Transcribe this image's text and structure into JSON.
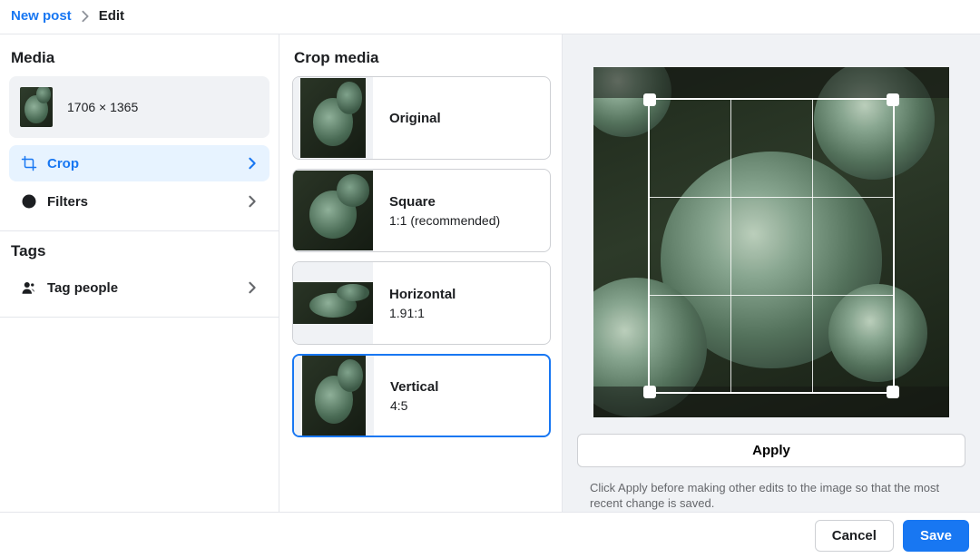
{
  "breadcrumb": {
    "back_label": "New post",
    "current_label": "Edit"
  },
  "sidebar": {
    "media_title": "Media",
    "media_dimensions": "1706 × 1365",
    "crop_label": "Crop",
    "filters_label": "Filters",
    "tags_title": "Tags",
    "tag_people_label": "Tag people"
  },
  "crop_panel": {
    "title": "Crop media",
    "options": [
      {
        "name": "Original",
        "ratio": ""
      },
      {
        "name": "Square",
        "ratio": "1:1 (recommended)"
      },
      {
        "name": "Horizontal",
        "ratio": "1.91:1"
      },
      {
        "name": "Vertical",
        "ratio": "4:5"
      }
    ],
    "selected_index": 3
  },
  "preview": {
    "apply_label": "Apply",
    "hint_text": "Click Apply before making other edits to the image so that the most recent change is saved."
  },
  "footer": {
    "cancel_label": "Cancel",
    "save_label": "Save"
  }
}
